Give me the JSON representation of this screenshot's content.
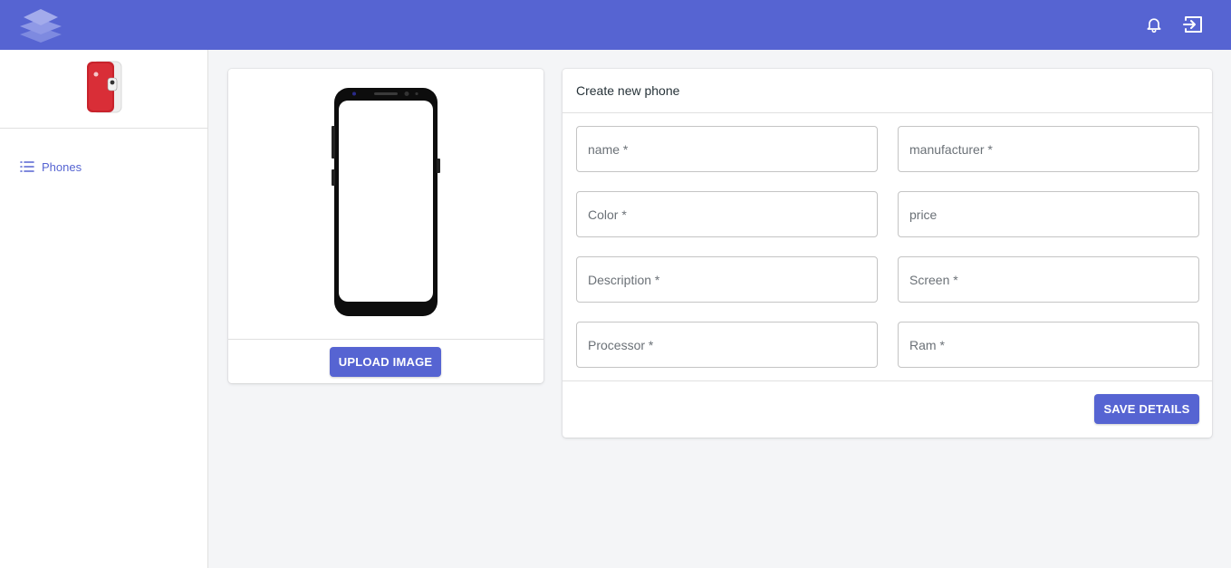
{
  "colors": {
    "primary": "#5664d2",
    "background": "#f4f5f7",
    "surface": "#ffffff"
  },
  "topbar": {
    "logo_icon": "layers-icon",
    "notifications_icon": "bell-icon",
    "logout_icon": "logout-icon"
  },
  "sidebar": {
    "avatar_icon": "red-phone-avatar",
    "items": [
      {
        "label": "Phones",
        "icon": "list-icon"
      }
    ]
  },
  "image_card": {
    "preview_icon": "phone-preview-image",
    "upload_label": "UPLOAD IMAGE"
  },
  "form": {
    "title": "Create new phone",
    "fields": {
      "name": {
        "placeholder": "name *",
        "value": ""
      },
      "manufacturer": {
        "placeholder": "manufacturer *",
        "value": ""
      },
      "color": {
        "placeholder": "Color *",
        "value": ""
      },
      "price": {
        "placeholder": "price",
        "value": ""
      },
      "description": {
        "placeholder": "Description *",
        "value": ""
      },
      "screen": {
        "placeholder": "Screen *",
        "value": ""
      },
      "processor": {
        "placeholder": "Processor *",
        "value": ""
      },
      "ram": {
        "placeholder": "Ram *",
        "value": ""
      }
    },
    "save_label": "SAVE DETAILS"
  }
}
